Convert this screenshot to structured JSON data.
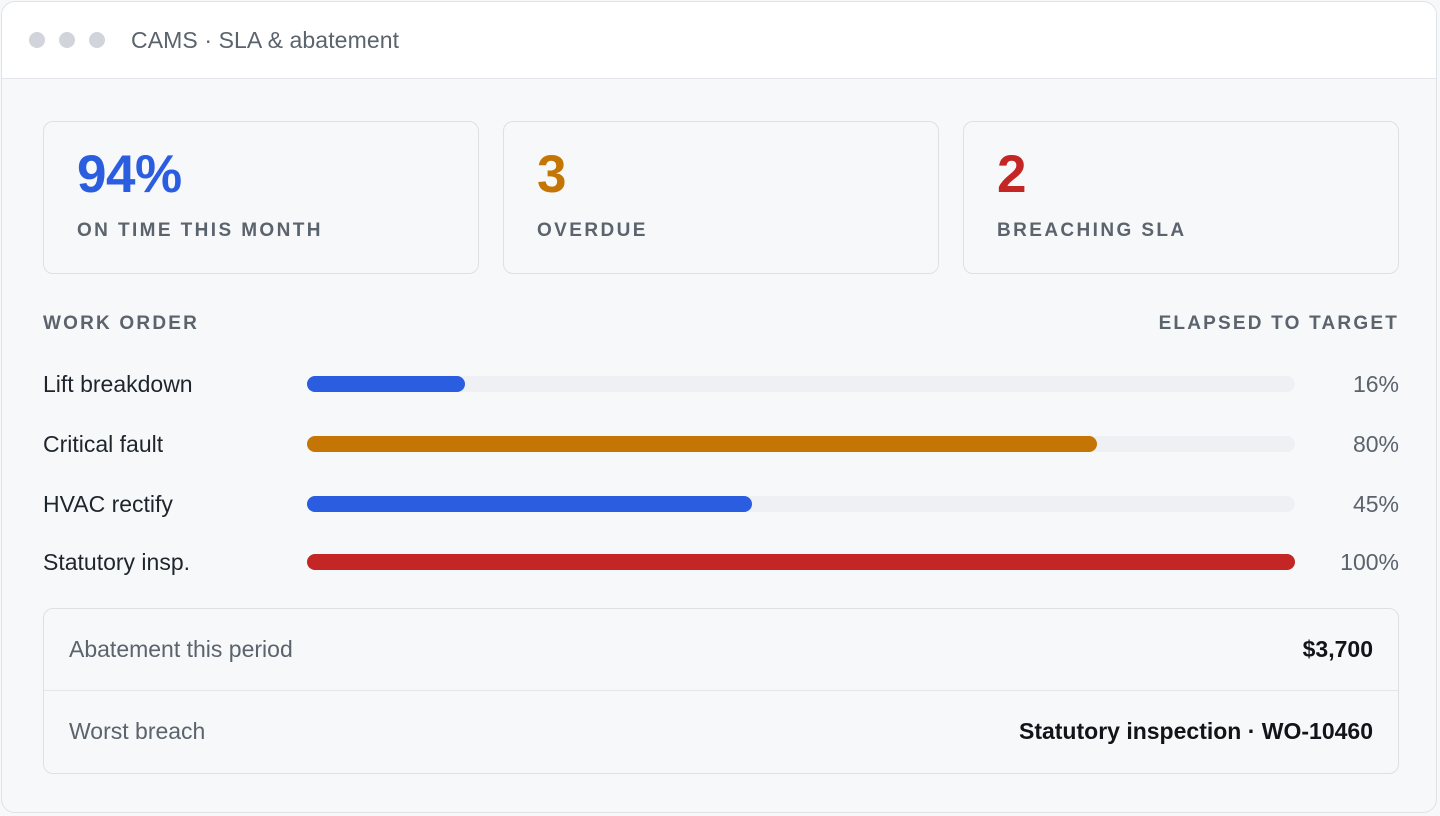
{
  "window": {
    "title": "CAMS · SLA & abatement"
  },
  "stats": [
    {
      "value": "94%",
      "label": "ON TIME THIS MONTH",
      "color": "#2b5de0"
    },
    {
      "value": "3",
      "label": "OVERDUE",
      "color": "#c57503"
    },
    {
      "value": "2",
      "label": "BREACHING SLA",
      "color": "#c42626"
    }
  ],
  "list": {
    "col_left": "WORK ORDER",
    "col_right": "ELAPSED TO TARGET",
    "rows": [
      {
        "label": "Lift breakdown",
        "pct_text": "16%",
        "pct": 16,
        "color": "#2b5de0"
      },
      {
        "label": "Critical fault",
        "pct_text": "80%",
        "pct": 80,
        "color": "#c57503"
      },
      {
        "label": "HVAC rectify",
        "pct_text": "45%",
        "pct": 45,
        "color": "#2b5de0"
      },
      {
        "label": "Statutory insp.",
        "pct_text": "100%",
        "pct": 100,
        "color": "#c42626"
      }
    ]
  },
  "summary": {
    "abatement_label": "Abatement this period",
    "abatement_value": "$3,700",
    "worst_label": "Worst breach",
    "worst_value": "Statutory inspection · WO-10460"
  }
}
